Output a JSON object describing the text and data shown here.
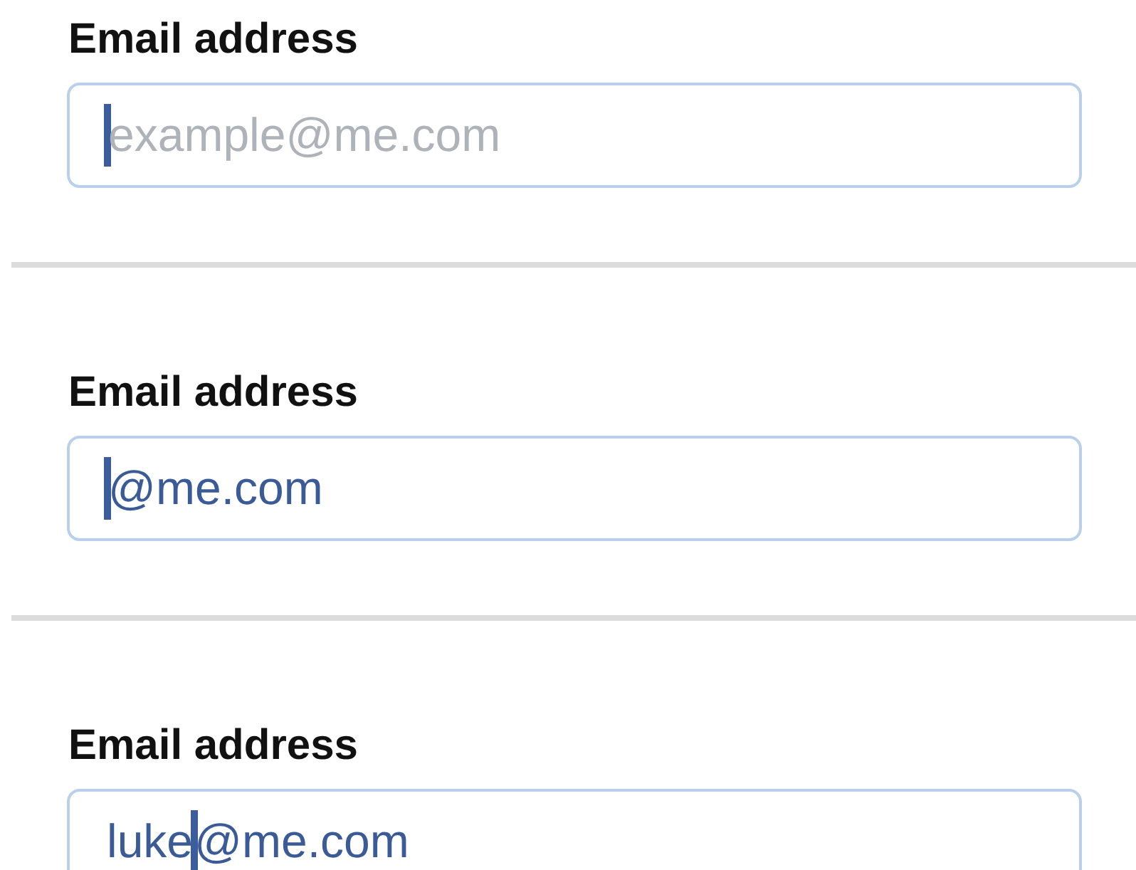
{
  "fields": [
    {
      "label": "Email address",
      "placeholder": "example@me.com"
    },
    {
      "label": "Email address",
      "suffix": "@me.com"
    },
    {
      "label": "Email address",
      "typed": "luke",
      "suffix": "@me.com"
    }
  ]
}
